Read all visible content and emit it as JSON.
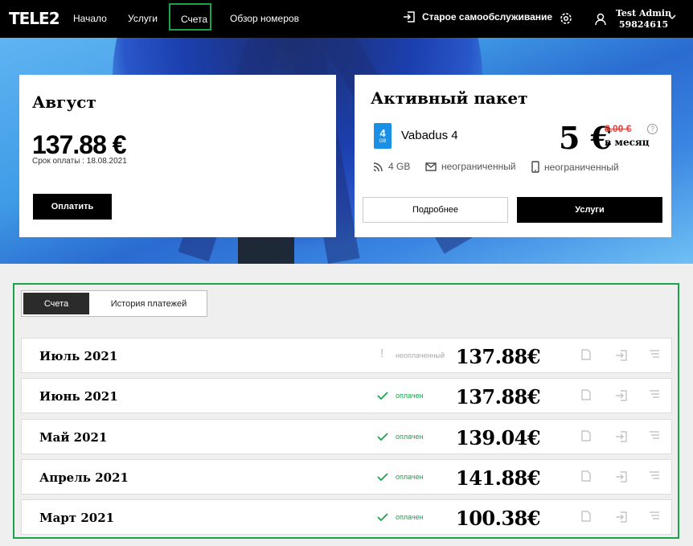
{
  "header": {
    "logo": "TELE2",
    "nav": [
      "Начало",
      "Услуги",
      "Счета",
      "Обзор номеров"
    ],
    "old_self_service": "Старое самообслуживание",
    "user_name": "Test Admin",
    "user_number": "59824615"
  },
  "invoice_card": {
    "month": "Август",
    "amount": "137.88 €",
    "due": "Срок оплаты : 18.08.2021",
    "pay_button": "Оплатить"
  },
  "package_card": {
    "title": "Активный пакет",
    "sim_number": "4",
    "sim_unit": "GB",
    "name": "Vabadus 4",
    "price": "5 €",
    "old_price": "8.00 €",
    "per_month": "в месяц",
    "help": "?",
    "features": [
      "4 GB",
      "неограниченный",
      "неограниченный"
    ],
    "details_button": "Подробнее",
    "services_button": "Услуги"
  },
  "bills": {
    "tabs": [
      "Счета",
      "История платежей"
    ],
    "rows": [
      {
        "month": "Июль 2021",
        "status": "неоплаченный",
        "paid": false,
        "amount": "137.88€"
      },
      {
        "month": "Июнь 2021",
        "status": "оплачен",
        "paid": true,
        "amount": "137.88€"
      },
      {
        "month": "Май 2021",
        "status": "оплачен",
        "paid": true,
        "amount": "139.04€"
      },
      {
        "month": "Апрель 2021",
        "status": "оплачен",
        "paid": true,
        "amount": "141.88€"
      },
      {
        "month": "Март 2021",
        "status": "оплачен",
        "paid": true,
        "amount": "100.38€"
      }
    ]
  },
  "colors": {
    "accent": "#1aa34a",
    "danger": "#e0413a",
    "sim": "#1a8fe6"
  }
}
